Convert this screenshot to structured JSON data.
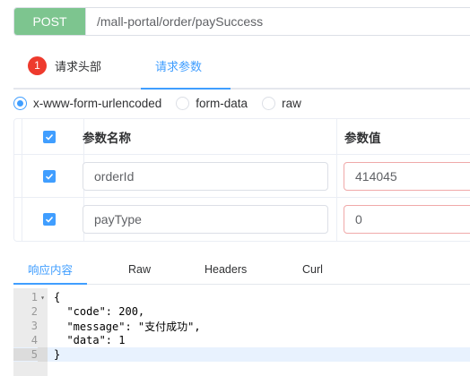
{
  "request": {
    "method": "POST",
    "url": "/mall-portal/order/paySuccess"
  },
  "tabs": {
    "headers_badge": "1",
    "headers_label": "请求头部",
    "params_label": "请求参数"
  },
  "body_types": [
    {
      "label": "x-www-form-urlencoded",
      "checked": true
    },
    {
      "label": "form-data",
      "checked": false
    },
    {
      "label": "raw",
      "checked": false
    }
  ],
  "params_table": {
    "col_name": "参数名称",
    "col_value": "参数值",
    "rows": [
      {
        "key": "orderId",
        "value": "414045",
        "checked": true
      },
      {
        "key": "payType",
        "value": "0",
        "checked": true
      }
    ]
  },
  "response_tabs": [
    "响应内容",
    "Raw",
    "Headers",
    "Curl"
  ],
  "response_lines": [
    {
      "num": "1",
      "fold": "▾",
      "text": "{"
    },
    {
      "num": "2",
      "fold": "",
      "text": "  \"code\": 200,"
    },
    {
      "num": "3",
      "fold": "",
      "text": "  \"message\": \"支付成功\","
    },
    {
      "num": "4",
      "fold": "",
      "text": "  \"data\": 1"
    },
    {
      "num": "5",
      "fold": "",
      "text": "}"
    }
  ],
  "colors": {
    "accent": "#409eff",
    "method_bg": "#7dc58f",
    "badge_bg": "#ee3a2d"
  }
}
